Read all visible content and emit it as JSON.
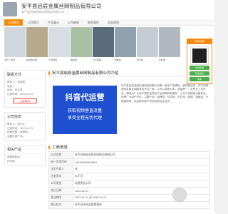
{
  "header": {
    "site_title": "安平县启辰金属丝网制品有限公司",
    "site_sub": "安平县启辰金属丝网制品有限公司"
  },
  "nav": {
    "items": [
      "公司首页",
      "公司简介",
      "产品展示",
      "公司新闻",
      "联系我们",
      "企业资质",
      "",
      ""
    ]
  },
  "banner": {
    "captions": [
      "冲孔丁型网",
      "镀锌铁丝网",
      "不锈钢网",
      "电焊网",
      "刀片刺绳",
      "钢格板",
      "勾花网",
      "护栏网"
    ]
  },
  "float_panel": {
    "title": "扫码访问",
    "btn1": "在线咨询",
    "btn2": "联系我们",
    "btn3": "留言"
  },
  "sidebar": {
    "contact_title": "联系方式",
    "contact_lines": [
      "联系人：张经理",
      "电话：",
      "地址：安平县",
      "注册时间：2012-11-21"
    ],
    "contact_button": "立即联系",
    "company_title": "公司信息",
    "company_lines": [
      "联系人：张先生",
      "注册时间：2012-11-21",
      "经营范围：电焊网...",
      "金属丝网产品..."
    ],
    "related_title": "相关产品",
    "related_lines": [
      "电焊网制品",
      "护栏网"
    ]
  },
  "main": {
    "title": "安平县启辰金属丝网制品有限公司介绍",
    "ad_title": "抖音代运营",
    "ad_line1": "获取视频垂直流量",
    "ad_line2": "享受全程无忧代理",
    "ad_line3": "",
    "desc": "安平县启辰金属丝网制品有限公司是一家生产电焊网、镀锌铁丝网、护栏网等各种金属丝网制品的专业厂家。公司以诚信为本，质量第一，信誉至上为宗旨，竭诚为广大用户提供优质的产品和周到的服务。公司产品畅销全国各地，深受广大用户好评。主要产品：电焊网、勾花网、护栏网、刺绳、钢格板、不锈钢网等。欢迎新老客户来电咨询洽谈合作。",
    "info_title": "工商信息",
    "info_rows": [
      {
        "k": "企业名称",
        "v": "安平县启辰金属丝网制品有限公司"
      },
      {
        "k": "统一信用代码",
        "v": "131125000019391"
      },
      {
        "k": "法定代表人",
        "v": "张"
      },
      {
        "k": "注册资本",
        "v": "50万元"
      },
      {
        "k": "公司类型",
        "v": "有限责任公司"
      },
      {
        "k": "成立日期",
        "v": "2012-11-21"
      },
      {
        "k": "营业期限",
        "v": "2012-11-21 至 2026-01-01"
      },
      {
        "k": "登记机关",
        "v": "安平县市场监督管理局"
      }
    ]
  }
}
